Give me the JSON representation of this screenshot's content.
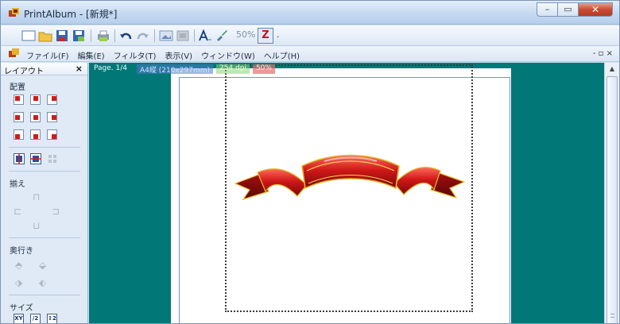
{
  "window": {
    "title": "PrintAlbum - [新規*]"
  },
  "toolbar": {
    "icons": [
      "new-document-icon",
      "open-folder-icon",
      "save-icon",
      "save-as-icon",
      "print-icon",
      "undo-icon",
      "redo-icon",
      "image-icon",
      "image-gray-icon",
      "text-tool-icon",
      "paint-tool-icon"
    ],
    "zoom_label": "50%",
    "z_label": "Z"
  },
  "menu": {
    "items": [
      "ファイル(F)",
      "編集(E)",
      "フィルタ(T)",
      "表示(V)",
      "ウィンドウ(W)",
      "ヘルプ(H)"
    ],
    "mdi_controls": "- ▫ ×"
  },
  "panel": {
    "title": "レイアウト",
    "close": "×",
    "sections": {
      "arrange": "配置",
      "align": "揃え",
      "depth": "奥行き",
      "size": "サイズ"
    },
    "size_buttons": [
      "XY",
      "/2",
      "↕2"
    ]
  },
  "canvas": {
    "page": "Page. 1/4",
    "paper": "A4縦 (210x297mm)",
    "dpi": "254 dpi",
    "zoom": "50%"
  },
  "colors": {
    "canvas_bg": "#027777",
    "ribbon_red": "#c01515",
    "ribbon_gold": "#e6bd2c"
  }
}
